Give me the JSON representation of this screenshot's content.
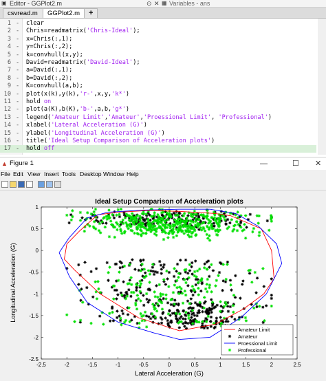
{
  "editor": {
    "title": "Editor - GGPlot2.m",
    "variables_title": "Variables - ans",
    "tabs": [
      {
        "label": "csvread.m"
      },
      {
        "label": "GGPlot2.m"
      }
    ],
    "lines": [
      {
        "n": "1",
        "segs": [
          {
            "t": "clear",
            "c": "n"
          }
        ]
      },
      {
        "n": "2",
        "segs": [
          {
            "t": "Chris=readmatrix(",
            "c": "n"
          },
          {
            "t": "'Chris-Ideal'",
            "c": "s"
          },
          {
            "t": ");",
            "c": "n"
          }
        ]
      },
      {
        "n": "3",
        "segs": [
          {
            "t": "x=Chris(:,1);",
            "c": "n"
          }
        ]
      },
      {
        "n": "4",
        "segs": [
          {
            "t": "y=Chris(:,2);",
            "c": "n"
          }
        ]
      },
      {
        "n": "5",
        "segs": [
          {
            "t": "k=convhull(x,y);",
            "c": "n"
          }
        ]
      },
      {
        "n": "6",
        "segs": [
          {
            "t": "David=readmatrix(",
            "c": "n"
          },
          {
            "t": "'David-Ideal'",
            "c": "s"
          },
          {
            "t": ");",
            "c": "n"
          }
        ]
      },
      {
        "n": "7",
        "segs": [
          {
            "t": "a=David(:,1);",
            "c": "n"
          }
        ]
      },
      {
        "n": "8",
        "segs": [
          {
            "t": "b=David(:,2);",
            "c": "n"
          }
        ]
      },
      {
        "n": "9",
        "segs": [
          {
            "t": "K=convhull(a,b);",
            "c": "n"
          }
        ]
      },
      {
        "n": "10",
        "segs": [
          {
            "t": "plot(x(k),y(k),",
            "c": "n"
          },
          {
            "t": "'r-'",
            "c": "s"
          },
          {
            "t": ",x,y,",
            "c": "n"
          },
          {
            "t": "'k*'",
            "c": "s"
          },
          {
            "t": ")",
            "c": "n"
          }
        ]
      },
      {
        "n": "11",
        "segs": [
          {
            "t": "hold ",
            "c": "n"
          },
          {
            "t": "on",
            "c": "s"
          }
        ]
      },
      {
        "n": "12",
        "segs": [
          {
            "t": "plot(a(K),b(K),",
            "c": "n"
          },
          {
            "t": "'b-'",
            "c": "s"
          },
          {
            "t": ",a,b,",
            "c": "n"
          },
          {
            "t": "'g*'",
            "c": "s"
          },
          {
            "t": ")",
            "c": "n"
          }
        ]
      },
      {
        "n": "13",
        "segs": [
          {
            "t": "legend(",
            "c": "n"
          },
          {
            "t": "'Amateur Limit'",
            "c": "s"
          },
          {
            "t": ",",
            "c": "n"
          },
          {
            "t": "'Amateur'",
            "c": "s"
          },
          {
            "t": ",",
            "c": "n"
          },
          {
            "t": "'Proessional Limit'",
            "c": "s"
          },
          {
            "t": ", ",
            "c": "n"
          },
          {
            "t": "'Professional'",
            "c": "s"
          },
          {
            "t": ")",
            "c": "n"
          }
        ]
      },
      {
        "n": "14",
        "segs": [
          {
            "t": "xlabel(",
            "c": "n"
          },
          {
            "t": "'Lateral Acceleration (G)'",
            "c": "s"
          },
          {
            "t": ")",
            "c": "n"
          }
        ]
      },
      {
        "n": "15",
        "segs": [
          {
            "t": "ylabel(",
            "c": "n"
          },
          {
            "t": "'Longitudinal Acceleration (G)'",
            "c": "s"
          },
          {
            "t": ")",
            "c": "n"
          }
        ]
      },
      {
        "n": "16",
        "segs": [
          {
            "t": "title(",
            "c": "n"
          },
          {
            "t": "'Ideal Setup Comparison of Acceleration plots'",
            "c": "s"
          },
          {
            "t": ")",
            "c": "n"
          }
        ]
      },
      {
        "n": "17",
        "segs": [
          {
            "t": "hold ",
            "c": "n"
          },
          {
            "t": "off",
            "c": "s"
          }
        ]
      }
    ]
  },
  "figure": {
    "title": "Figure 1",
    "menu": [
      "File",
      "Edit",
      "View",
      "Insert",
      "Tools",
      "Desktop",
      "Window",
      "Help"
    ]
  },
  "chart_data": {
    "type": "scatter",
    "title": "Ideal Setup Comparison of Acceleration plots",
    "xlabel": "Lateral Acceleration (G)",
    "ylabel": "Longitudinal Acceleration (G)",
    "xlim": [
      -2.5,
      2.5
    ],
    "ylim": [
      -2.5,
      1
    ],
    "xticks": [
      "-2.5",
      "-2",
      "-1.5",
      "-1",
      "-0.5",
      "0",
      "0.5",
      "1",
      "1.5",
      "2",
      "2.5"
    ],
    "yticks": [
      "1",
      "0.5",
      "0",
      "-0.5",
      "-1",
      "-1.5",
      "-2",
      "-2.5"
    ],
    "legend_position": "bottom-right",
    "series": [
      {
        "name": "Amateur Limit",
        "kind": "line",
        "color": "#ff0000",
        "x": [
          -2.05,
          -1.85,
          -1.35,
          -0.6,
          0.2,
          0.9,
          1.45,
          1.85,
          2.05,
          2.0,
          1.8,
          1.2,
          0.9,
          0.2,
          -0.4,
          -1.0,
          -1.4,
          -1.75,
          -2.0,
          -2.05
        ],
        "y": [
          -0.2,
          -0.45,
          -1.0,
          -1.55,
          -1.85,
          -1.7,
          -1.35,
          -1.0,
          -0.65,
          0.0,
          0.5,
          0.8,
          0.85,
          0.9,
          0.92,
          0.88,
          0.82,
          0.45,
          0.15,
          -0.2
        ]
      },
      {
        "name": "Amateur",
        "kind": "points",
        "marker": "*",
        "color": "#000000"
      },
      {
        "name": "Proessional Limit",
        "kind": "line",
        "color": "#0000ff",
        "x": [
          -2.15,
          -1.95,
          -1.6,
          -1.0,
          -0.3,
          0.2,
          0.8,
          1.4,
          1.9,
          2.2,
          2.1,
          1.75,
          1.3,
          0.8,
          0.2,
          -0.5,
          -1.2,
          -1.6,
          -1.95,
          -2.15
        ],
        "y": [
          -0.05,
          -0.6,
          -1.2,
          -1.65,
          -1.9,
          -2.05,
          -2.0,
          -1.55,
          -1.0,
          -0.3,
          0.15,
          0.55,
          0.85,
          0.95,
          0.95,
          0.93,
          0.88,
          0.75,
          0.3,
          -0.05
        ]
      },
      {
        "name": "Professional",
        "kind": "points",
        "marker": "*",
        "color": "#00ff00"
      }
    ]
  }
}
